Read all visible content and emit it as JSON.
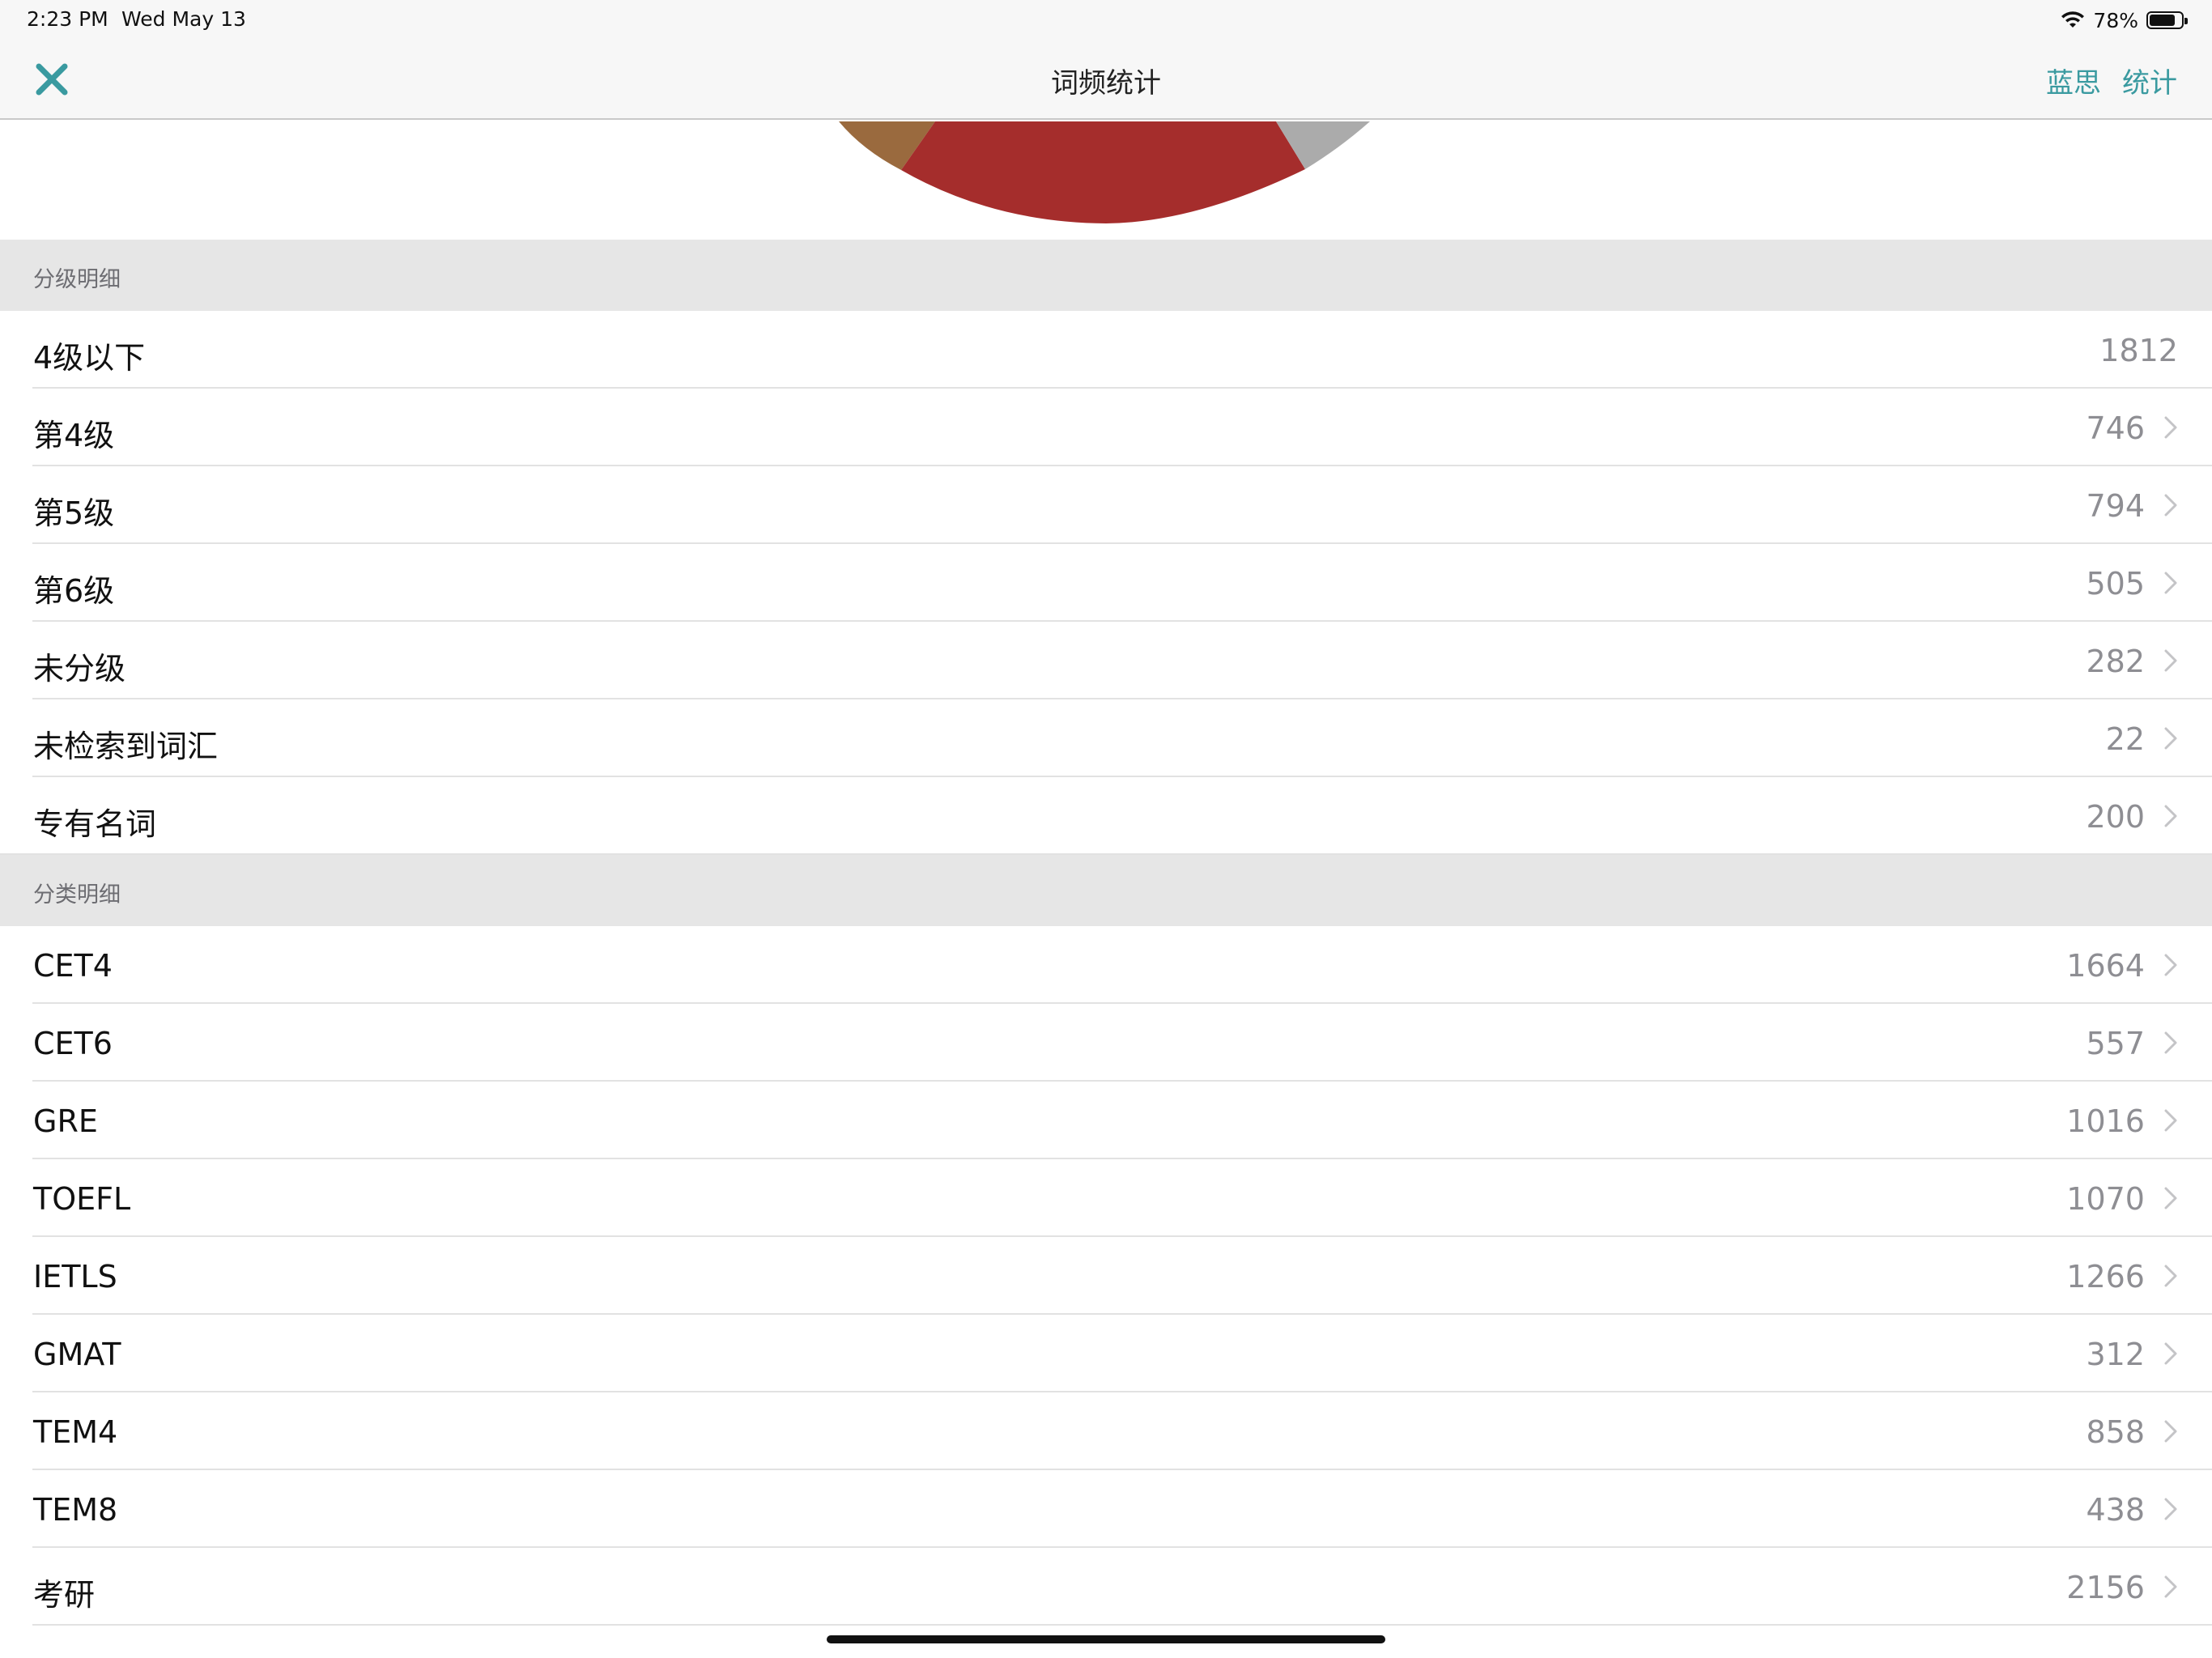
{
  "status_bar": {
    "time": "2:23 PM",
    "date": "Wed May 13",
    "battery": "78%",
    "battery_level": 0.78
  },
  "nav": {
    "title": "词频统计",
    "actions": [
      "蓝思",
      "统计"
    ],
    "accent_color": "#3a9aa0"
  },
  "pie_colors": {
    "brown": "#9a6a3e",
    "red": "#a52d2c",
    "gray": "#ababab"
  },
  "level_section": {
    "header": "分级明细",
    "rows": [
      {
        "label": "4级以下",
        "value": "1812",
        "chevron": false
      },
      {
        "label": "第4级",
        "value": "746",
        "chevron": true
      },
      {
        "label": "第5级",
        "value": "794",
        "chevron": true
      },
      {
        "label": "第6级",
        "value": "505",
        "chevron": true
      },
      {
        "label": "未分级",
        "value": "282",
        "chevron": true
      },
      {
        "label": "未检索到词汇",
        "value": "22",
        "chevron": true
      },
      {
        "label": "专有名词",
        "value": "200",
        "chevron": true
      }
    ]
  },
  "category_section": {
    "header": "分类明细",
    "rows": [
      {
        "label": "CET4",
        "value": "1664",
        "chevron": true
      },
      {
        "label": "CET6",
        "value": "557",
        "chevron": true
      },
      {
        "label": "GRE",
        "value": "1016",
        "chevron": true
      },
      {
        "label": "TOEFL",
        "value": "1070",
        "chevron": true
      },
      {
        "label": "IETLS",
        "value": "1266",
        "chevron": true
      },
      {
        "label": "GMAT",
        "value": "312",
        "chevron": true
      },
      {
        "label": "TEM4",
        "value": "858",
        "chevron": true
      },
      {
        "label": "TEM8",
        "value": "438",
        "chevron": true
      },
      {
        "label": "考研",
        "value": "2156",
        "chevron": true
      }
    ]
  }
}
